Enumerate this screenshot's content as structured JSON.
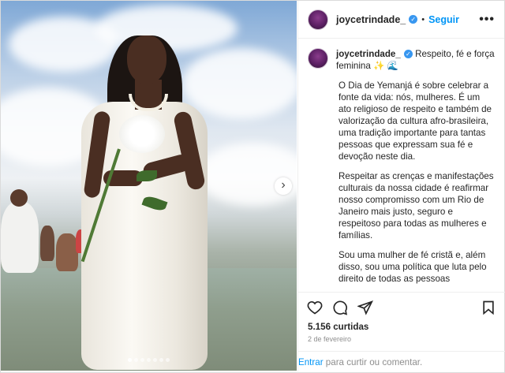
{
  "post": {
    "username": "joycetrindade_",
    "follow_label": "Seguir",
    "more_label": "•••",
    "caption_title": "Respeito, fé e força feminina ✨ 🌊",
    "paragraphs": [
      "O Dia de Yemanjá é sobre celebrar a fonte da vida: nós, mulheres. É um ato religioso de respeito e também de valorização da cultura afro-brasileira, uma tradição importante para tantas pessoas que expressam sua fé e devoção neste dia.",
      "Respeitar as crenças e manifestações culturais da nossa cidade é reafirmar nosso compromisso com um Rio de Janeiro mais justo, seguro e respeitoso para todas as mulheres e famílias.",
      "Sou uma mulher de fé cristã e, além disso, sou uma política que luta pelo direito de todas as pessoas culturarem livremente sua fé. A fé é o que nos une"
    ],
    "likes": "5.156 curtidas",
    "date": "2 de fevereiro",
    "comment_link": "Entrar",
    "comment_text": " para curtir ou comentar."
  },
  "carousel": {
    "next_icon": "chevron-right-icon",
    "dots": 7,
    "active_dot": 0
  },
  "icons": {
    "like": "heart-icon",
    "comment": "comment-icon",
    "share": "share-icon",
    "save": "bookmark-icon",
    "verified": "verified-badge-icon"
  },
  "colors": {
    "accent": "#0095f6",
    "verified": "#3897f0",
    "text": "#262626",
    "muted": "#8e8e8e"
  }
}
